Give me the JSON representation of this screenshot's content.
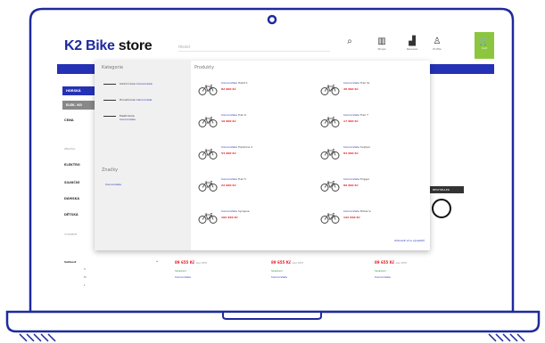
{
  "header": {
    "logo": {
      "k2": "K2",
      "bike": "Bike",
      "store": "store"
    },
    "search_placeholder": "Hledat",
    "icons": [
      {
        "name": "search-icon",
        "glyph": "⌕",
        "label": ""
      },
      {
        "name": "compare-icon",
        "glyph": "▥",
        "label": "Shops"
      },
      {
        "name": "reviews-icon",
        "glyph": "▟",
        "label": "Reviews"
      },
      {
        "name": "user-icon",
        "glyph": "♙",
        "label": "Profile"
      }
    ],
    "cart": {
      "glyph": "🛒",
      "label": "Cart"
    },
    "colors": {
      "brand": "#1e2a9c",
      "nav": "#2532b5",
      "cart": "#8cc63f",
      "price": "#e41e26"
    }
  },
  "behind": {
    "left_button_1": "HORSKÁ",
    "left_button_2": "ELEK. KO",
    "cena_label": "CENA",
    "labels": [
      "ZNAČKA",
      "ELEKTRO",
      "SILNIČNÍ",
      "DÁMSKÁ",
      "DĚTSKÁ"
    ],
    "vyrobce_label": "VÝROBCE"
  },
  "mega": {
    "categories_heading": "Kategorie",
    "categories": [
      {
        "text": "Silniční kola",
        "highlight": "Cannondale"
      },
      {
        "text": "Horská kola",
        "highlight": "Cannondale"
      },
      {
        "text": "Elektrokola",
        "highlight": "Cannondale"
      }
    ],
    "brands_heading": "Značky",
    "brand_item": "Cannondale",
    "products_heading": "Produkty",
    "products": [
      {
        "brand": "Cannondale",
        "model": "Habit 1",
        "price": "82 990 Kč"
      },
      {
        "brand": "Cannondale",
        "model": "Trail SL",
        "price": "36 990 Kč"
      },
      {
        "brand": "Cannondale",
        "model": "Trail 6",
        "price": "19 990 Kč"
      },
      {
        "brand": "Cannondale",
        "model": "Trail 7",
        "price": "17 990 Kč"
      },
      {
        "brand": "Cannondale",
        "model": "Topstone 2",
        "price": "54 990 Kč"
      },
      {
        "brand": "Cannondale",
        "model": "Scalpel",
        "price": "84 990 Kč"
      },
      {
        "brand": "Cannondale",
        "model": "Trail 5",
        "price": "22 990 Kč"
      },
      {
        "brand": "Cannondale",
        "model": "Trigger",
        "price": "89 990 Kč"
      },
      {
        "brand": "Cannondale",
        "model": "Synapse",
        "price": "102 990 Kč"
      },
      {
        "brand": "Cannondale",
        "model": "Moterra",
        "price": "122 990 Kč"
      }
    ],
    "show_all": "Zobrazit více výsledků"
  },
  "hero_tag": "BESTSELLER",
  "filters": {
    "heading": "Velikost",
    "options": [
      "S",
      "M",
      "L"
    ]
  },
  "cards": [
    {
      "price": "89 655 Kč",
      "was": "bez DPH",
      "stock": "Skladem",
      "link": "Cannondale"
    },
    {
      "price": "89 655 Kč",
      "was": "bez DPH",
      "stock": "Skladem",
      "link": "Cannondale"
    },
    {
      "price": "89 655 Kč",
      "was": "bez DPH",
      "stock": "Skladem",
      "link": "Cannondale"
    }
  ]
}
